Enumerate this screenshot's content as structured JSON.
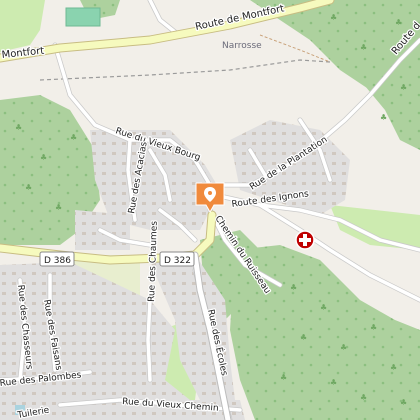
{
  "map": {
    "streets": {
      "route_de_montfort_east": "Route de Montfort",
      "route_de_montfort_west": "Montfort",
      "route_top_right": "Route d",
      "rue_du_vieux_bourg": "Rue du Vieux Bourg",
      "rue_des_acacias": "Rue des Acacias",
      "rue_de_la_plantation": "Rue de la Plantation",
      "route_des_ignons": "Route des Ignons",
      "chemin_du_ruisseau": "Chemin du Ruisseau",
      "rue_des_chasseurs": "Rue des Chasseurs",
      "rue_des_faisans": "Rue des Faisans",
      "rue_des_chaumes": "Rue des Chaumes",
      "rue_des_ecoles": "Rue des Écoles",
      "rue_des_palombes": "Rue des Palombes",
      "rue_du_vieux_chemin": "Rue du Vieux Chemin",
      "tuilerie": "Tuilerie"
    },
    "road_refs": {
      "d386": "D 386",
      "d322": "D 322"
    },
    "locality": "Narrosse",
    "colors": {
      "background": "#f2efe9",
      "forest": "#add19e",
      "grass": "#cdebb0",
      "residential": "#e0dfdf",
      "primary_road": "#f6fabe",
      "marker": "#f08a3c",
      "hospital_symbol": "#bf0000"
    },
    "markers": [
      {
        "name": "location-marker",
        "icon": "pin-icon"
      },
      {
        "name": "hospital-marker",
        "icon": "hospital-cross-icon"
      }
    ]
  }
}
